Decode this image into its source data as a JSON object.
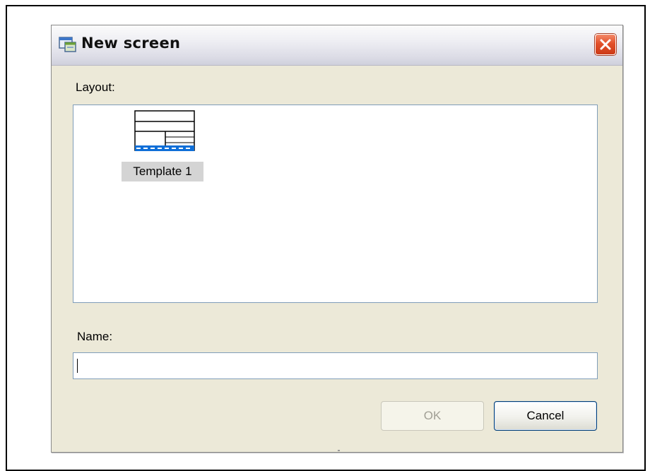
{
  "dialog": {
    "title": "New screen",
    "close_icon": "close-icon"
  },
  "layout": {
    "label": "Layout:",
    "items": [
      {
        "label": "Template 1",
        "icon": "template-layout-icon",
        "selected": true
      }
    ]
  },
  "name": {
    "label": "Name:",
    "value": "",
    "placeholder": ""
  },
  "buttons": {
    "ok_label": "OK",
    "ok_enabled": false,
    "cancel_label": "Cancel"
  },
  "colors": {
    "close_button": "#e2502a",
    "list_border": "#7f9db9",
    "selection_highlight": "#d4d4d4",
    "template_accent": "#0f6fd8"
  }
}
